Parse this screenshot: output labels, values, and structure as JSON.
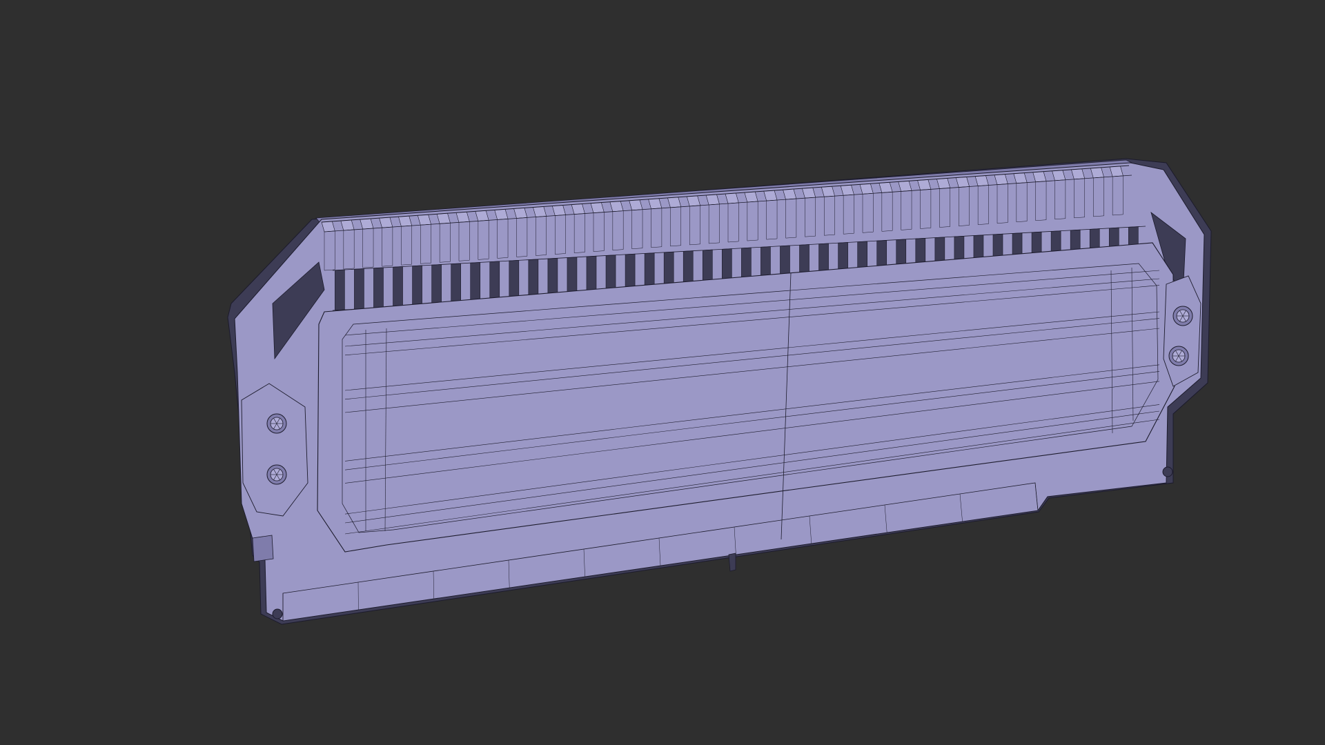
{
  "viewport": {
    "background": "#2f2f2f"
  },
  "model": {
    "subject": "ram-heatsink-wireframe",
    "shading": "wireframe-on-shaded",
    "fill_color": "#9b98c6",
    "fill_dark": "#7f7cab",
    "fill_light": "#aeabd6",
    "shadow_color": "#3d3c55",
    "wire_color": "#1c1b2c",
    "fin_count": 42,
    "screw_count": 4,
    "mount_hole_count": 2
  }
}
